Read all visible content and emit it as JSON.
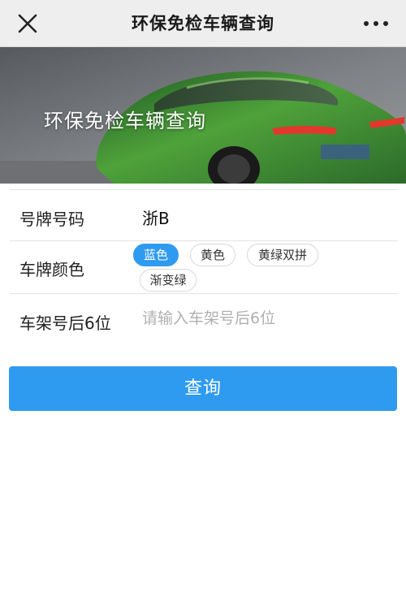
{
  "nav": {
    "title": "环保免检车辆查询"
  },
  "banner": {
    "title": "环保免检车辆查询"
  },
  "form": {
    "plate_number": {
      "label": "号牌号码",
      "value": "浙B"
    },
    "plate_color": {
      "label": "车牌颜色",
      "options": [
        "蓝色",
        "黄色",
        "黄绿双拼",
        "渐变绿"
      ],
      "selected": "蓝色"
    },
    "vin_last6": {
      "label": "车架号后6位",
      "placeholder": "请输入车架号后6位",
      "value": ""
    }
  },
  "actions": {
    "query_label": "查询"
  },
  "colors": {
    "accent": "#2f9bf0",
    "navbar_bg": "#eeeeee",
    "placeholder": "#b0b0b0"
  }
}
